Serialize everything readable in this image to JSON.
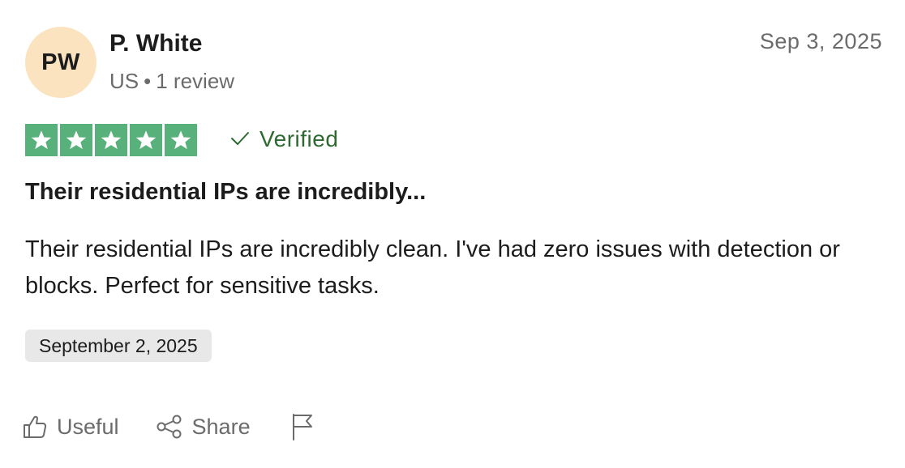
{
  "reviewer": {
    "initials": "PW",
    "name": "P. White",
    "country": "US",
    "separator": "•",
    "review_count": "1 review"
  },
  "review": {
    "date": "Sep 3, 2025",
    "rating": 5,
    "rating_max": 5,
    "verified_label": "Verified",
    "title": "Their residential IPs are incredibly...",
    "body": "Their residential IPs are incredibly clean. I've had zero issues with detection or blocks. Perfect for sensitive tasks.",
    "experience_date": "September 2, 2025"
  },
  "actions": {
    "useful_label": "Useful",
    "share_label": "Share"
  },
  "colors": {
    "star_green": "#58b07a",
    "verified_green": "#2e6a30",
    "avatar_bg": "#fce3c0",
    "muted_text": "#6b6b6b",
    "date_chip_bg": "#e8e8e8"
  },
  "icons": {
    "star": "star-icon",
    "verified": "checkmark-icon",
    "useful": "thumbs-up-icon",
    "share": "share-icon",
    "report": "flag-icon"
  }
}
